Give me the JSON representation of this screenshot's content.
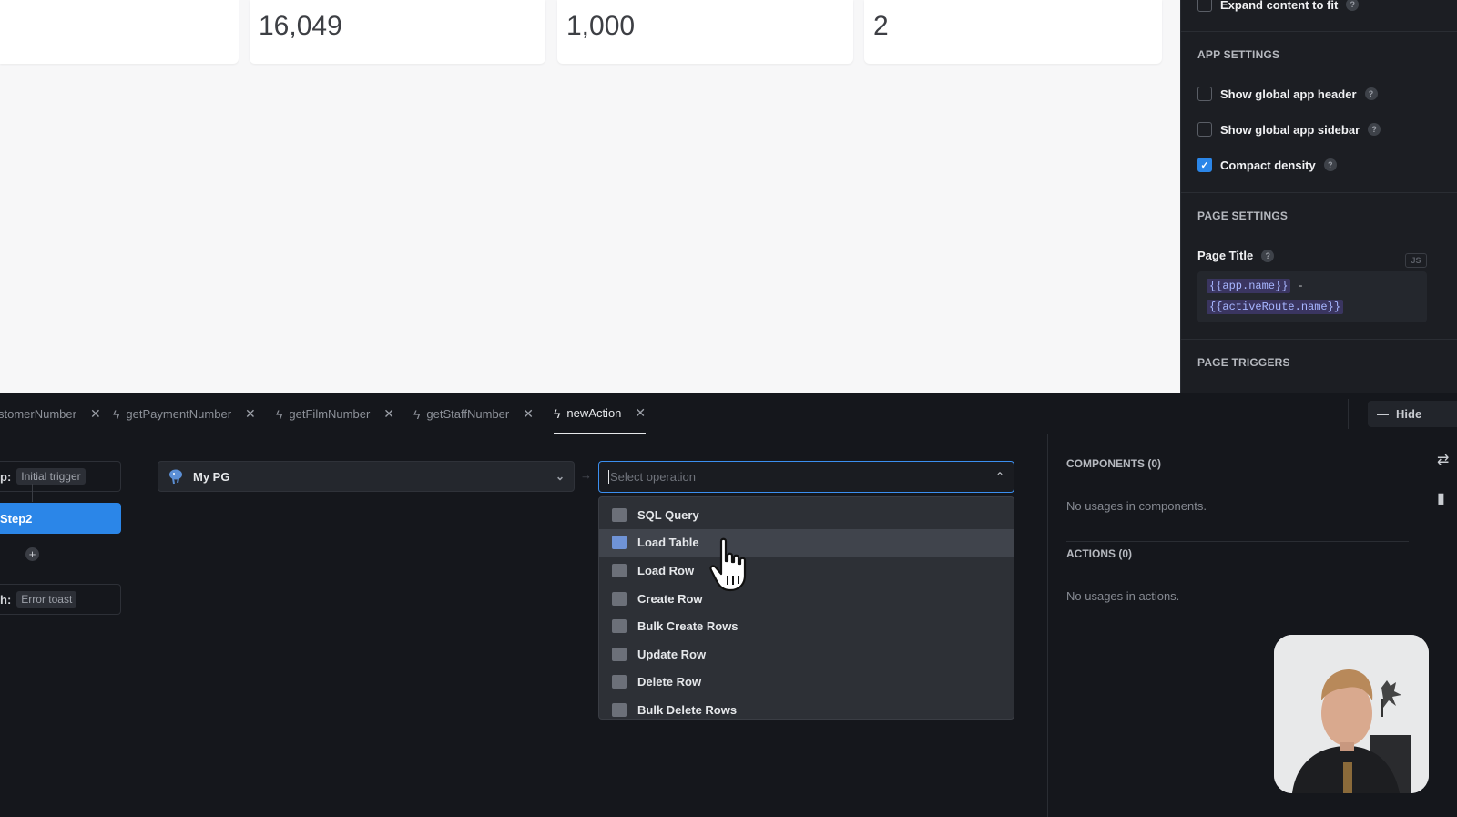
{
  "canvas": {
    "stat_cards": [
      {
        "value": ""
      },
      {
        "value": "16,049"
      },
      {
        "value": "1,000"
      },
      {
        "value": "2"
      }
    ]
  },
  "settings": {
    "expand_content": {
      "label": "Expand content to fit",
      "checked": false
    },
    "app_settings_title": "APP SETTINGS",
    "show_header": {
      "label": "Show global app header",
      "checked": false
    },
    "show_sidebar": {
      "label": "Show global app sidebar",
      "checked": false
    },
    "compact_density": {
      "label": "Compact density",
      "checked": true
    },
    "page_settings_title": "PAGE SETTINGS",
    "page_title_label": "Page Title",
    "js_badge": "JS",
    "page_title_value": {
      "part1": "{{app.name}}",
      "separator": "-",
      "part2": "{{activeRoute.name}}"
    },
    "page_triggers_title": "PAGE TRIGGERS"
  },
  "query_tabs": [
    {
      "label": "stomerNumber",
      "active": false
    },
    {
      "label": "getPaymentNumber",
      "active": false
    },
    {
      "label": "getFilmNumber",
      "active": false
    },
    {
      "label": "getStaffNumber",
      "active": false
    },
    {
      "label": "newAction",
      "active": true
    }
  ],
  "hide_button": "Hide",
  "flow": {
    "trigger_prefix": "p:",
    "trigger_chip": "Initial trigger",
    "step_label": "Step2",
    "error_prefix": "h:",
    "error_chip": "Error toast"
  },
  "resource_select": {
    "value": "My PG"
  },
  "operation_select": {
    "placeholder": "Select operation",
    "options": [
      {
        "label": "SQL Query"
      },
      {
        "label": "Load Table"
      },
      {
        "label": "Load Row"
      },
      {
        "label": "Create Row"
      },
      {
        "label": "Bulk Create Rows"
      },
      {
        "label": "Update Row"
      },
      {
        "label": "Delete Row"
      },
      {
        "label": "Bulk Delete Rows"
      }
    ],
    "highlighted": "Load Table"
  },
  "usages": {
    "components_title": "COMPONENTS (0)",
    "components_empty": "No usages in components.",
    "actions_title": "ACTIONS (0)",
    "actions_empty": "No usages in actions."
  },
  "colors": {
    "accent": "#2b86e8",
    "panel_bg": "#15171c",
    "canvas_bg": "#f7f7f8"
  }
}
